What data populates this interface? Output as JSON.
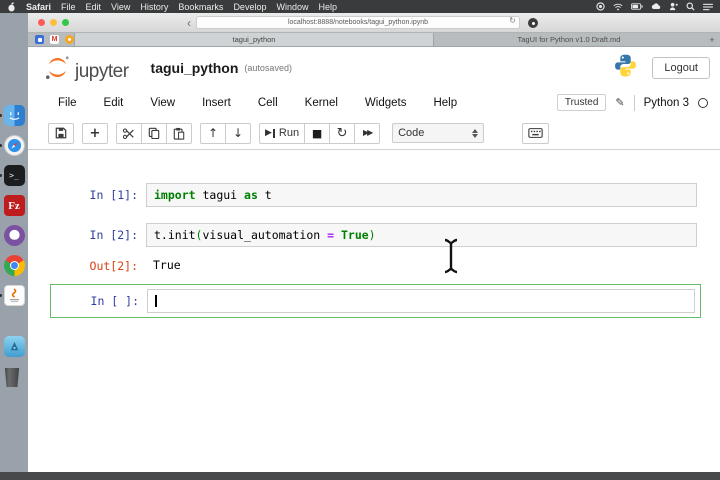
{
  "colors": {
    "jupyter_orange": "#F37626",
    "prompt_in_blue": "#303F9F",
    "prompt_out_red": "#D84315",
    "keyword_green": "#008000",
    "operator_purple": "#AA22FF",
    "active_cell_green": "#66BB6A"
  },
  "macos_menubar": {
    "app_name": "Safari",
    "items": [
      "File",
      "Edit",
      "View",
      "History",
      "Bookmarks",
      "Develop",
      "Window",
      "Help"
    ]
  },
  "browser": {
    "address": "localhost:8888/notebooks/tagui_python.ipynb",
    "tabs": {
      "active": "tagui_python",
      "inactive": "TagUI for Python v1.0 Draft.md",
      "new_tab": "+"
    }
  },
  "jupyter": {
    "logo_text": "jupyter",
    "title": "tagui_python",
    "autosave_status": "(autosaved)",
    "logout_label": "Logout",
    "menu": [
      "File",
      "Edit",
      "View",
      "Insert",
      "Cell",
      "Kernel",
      "Widgets",
      "Help"
    ],
    "trusted_label": "Trusted",
    "kernel_name": "Python 3",
    "toolbar": {
      "run_label": "Run",
      "cell_type": "Code"
    },
    "cells": {
      "cell1": {
        "prompt": "In [1]:",
        "code": [
          {
            "text": "import"
          },
          {
            "text": " tagui "
          },
          {
            "text": "as"
          },
          {
            "text": " t"
          }
        ]
      },
      "cell2": {
        "prompt": "In [2]:",
        "code": [
          {
            "text": "t.init"
          },
          {
            "text": "("
          },
          {
            "text": "visual_automation "
          },
          {
            "text": "= "
          },
          {
            "text": "True"
          },
          {
            "text": ")"
          }
        ]
      },
      "out2": {
        "prompt": "Out[2]:",
        "value": "True"
      },
      "cell3": {
        "prompt": "In [ ]:"
      }
    }
  }
}
